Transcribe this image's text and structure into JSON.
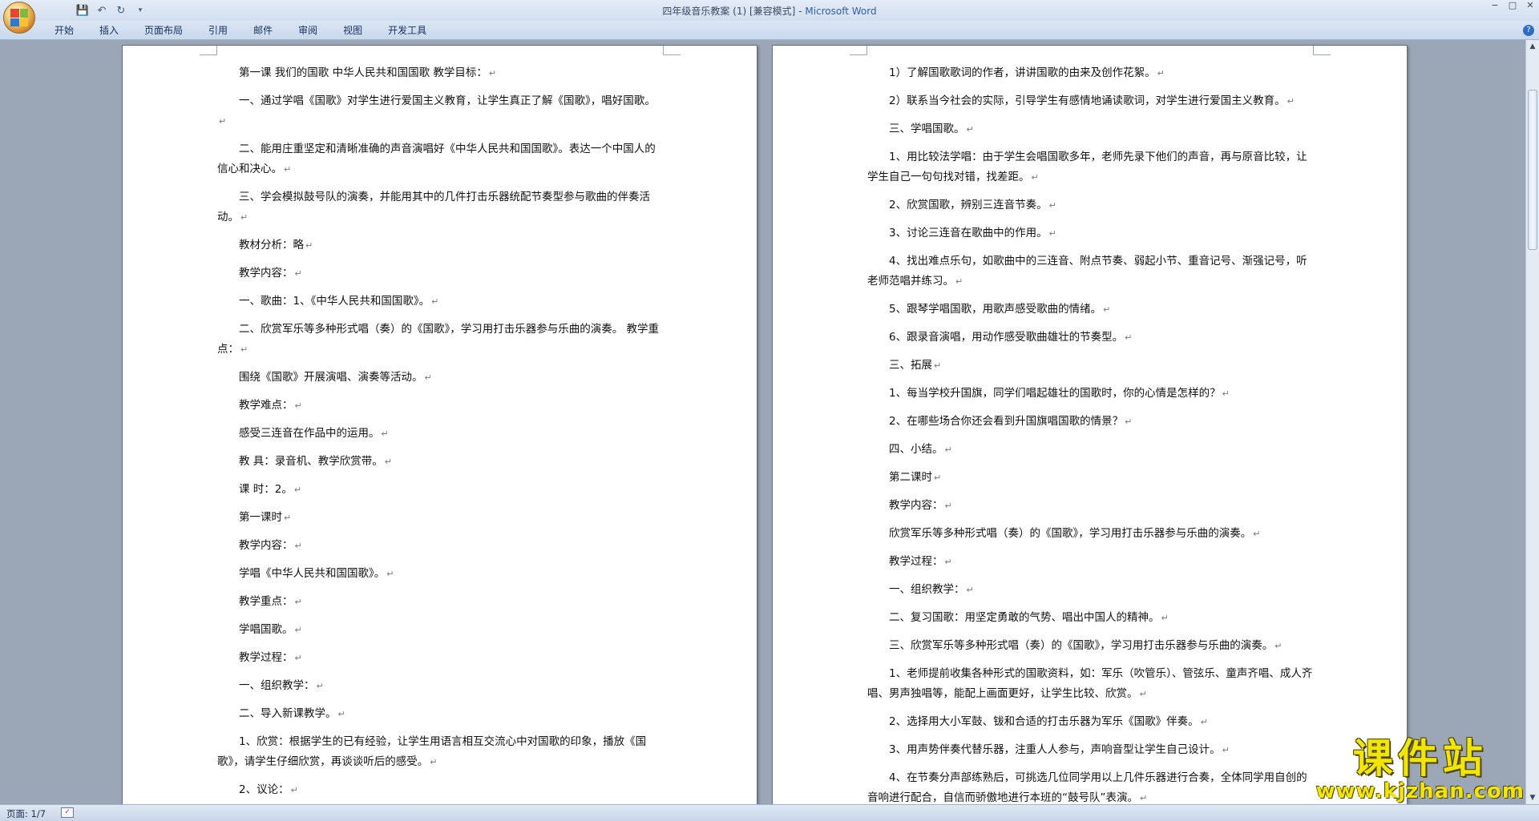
{
  "window": {
    "title": "四年级音乐教案 (1) [兼容模式]",
    "app_name": "Microsoft Word",
    "controls": [
      "−",
      "□",
      "✕"
    ]
  },
  "quick_access": {
    "save_icon": "save-icon",
    "undo_icon": "undo-icon",
    "redo_icon": "redo-icon",
    "customize_icon": "customize-icon"
  },
  "ribbon": {
    "tabs": [
      "开始",
      "插入",
      "页面布局",
      "引用",
      "邮件",
      "审阅",
      "视图",
      "开发工具"
    ],
    "help": "?"
  },
  "page1": {
    "paragraphs": [
      "第一课 我们的国歌 中华人民共和国国歌 教学目标：",
      "一、通过学唱《国歌》对学生进行爱国主义教育，让学生真正了解《国歌》，唱好国歌。",
      "二、能用庄重坚定和清晰准确的声音演唱好《中华人民共和国国歌》。表达一个中国人的信心和决心。",
      "三、学会模拟鼓号队的演奏，并能用其中的几件打击乐器统配节奏型参与歌曲的伴奏活动。",
      "教材分析：略",
      "教学内容：",
      "一、歌曲：1、《中华人民共和国国歌》。",
      "二、欣赏军乐等多种形式唱（奏）的《国歌》，学习用打击乐器参与乐曲的演奏。 教学重点：",
      "围绕《国歌》开展演唱、演奏等活动。",
      "教学难点：",
      "感受三连音在作品中的运用。",
      "教 具：录音机、教学欣赏带。",
      "课 时：2。",
      "第一课时",
      "教学内容：",
      "学唱《中华人民共和国国歌》。",
      "教学重点：",
      "学唱国歌。",
      "教学过程：",
      "一、组织教学：",
      "二、导入新课教学。",
      "1、欣赏：根据学生的已有经验，让学生用语言相互交流心中对国歌的印象，播放《国歌》，请学生仔细欣赏，再谈谈听后的感受。",
      "2、议论："
    ]
  },
  "page2": {
    "paragraphs": [
      "1）了解国歌歌词的作者，讲讲国歌的由来及创作花絮。",
      "2）联系当今社会的实际，引导学生有感情地诵读歌词，对学生进行爱国主义教育。",
      "三、学唱国歌。",
      "1、用比较法学唱：由于学生会唱国歌多年，老师先录下他们的声音，再与原音比较，让学生自己一句句找对错，找差距。",
      "2、欣赏国歌，辨别三连音节奏。",
      "3、讨论三连音在歌曲中的作用。",
      "4、找出难点乐句，如歌曲中的三连音、附点节奏、弱起小节、重音记号、渐强记号，听老师范唱并练习。",
      "5、跟琴学唱国歌，用歌声感受歌曲的情绪。",
      "6、跟录音演唱，用动作感受歌曲雄壮的节奏型。",
      "三、拓展",
      "1、每当学校升国旗，同学们唱起雄壮的国歌时，你的心情是怎样的？",
      "2、在哪些场合你还会看到升国旗唱国歌的情景？",
      "四、小结。",
      "第二课时",
      "教学内容：",
      "欣赏军乐等多种形式唱（奏）的《国歌》，学习用打击乐器参与乐曲的演奏。",
      "教学过程：",
      "一、组织教学：",
      "二、复习国歌：用坚定勇敢的气势、唱出中国人的精神。",
      "三、欣赏军乐等多种形式唱（奏）的《国歌》，学习用打击乐器参与乐曲的演奏。",
      "1、老师提前收集各种形式的国歌资料，如：军乐（吹管乐）、管弦乐、童声齐唱、成人齐唱、男声独唱等，能配上画面更好，让学生比较、欣赏。",
      "2、选择用大小军鼓、钹和合适的打击乐器为军乐《国歌》伴奏。",
      "3、用声势伴奏代替乐器，注重人人参与，声响音型让学生自己设计。",
      "4、在节奏分声部练熟后，可挑选几位同学用以上几件乐器进行合奏，全体同学用自创的音响进行配合，自信而骄傲地进行本班的“鼓号队”表演。"
    ]
  },
  "paragraph_mark": "↵",
  "statusbar": {
    "page": "页面: 1/7"
  },
  "watermark": {
    "title": "课件站",
    "url": "www.kjzhan.com"
  },
  "colors": {
    "workspace": "#9ba7b6",
    "accent": "#2f5fa8",
    "watermark": "#f2e600"
  }
}
